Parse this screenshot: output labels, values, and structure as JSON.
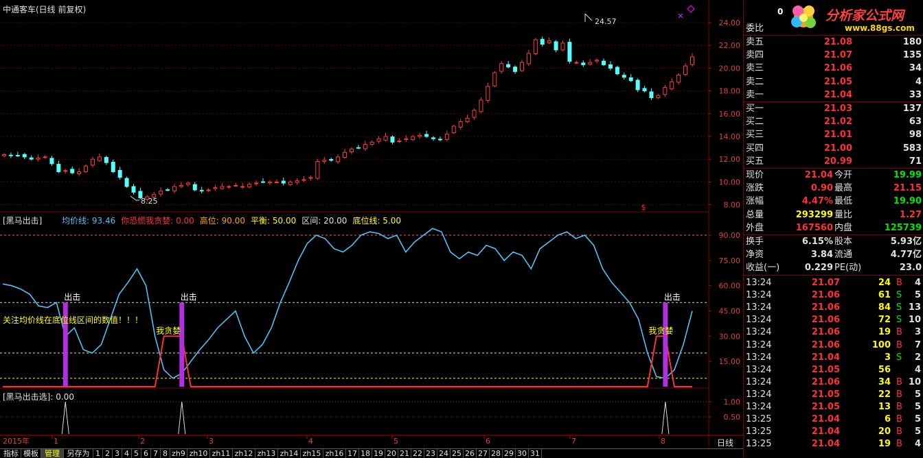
{
  "header": {
    "stock_title": "中通客车(日线 前复权)",
    "peak_label": "24.57",
    "low_label": "8.25",
    "price_ticks": [
      "24.00",
      "22.00",
      "20.00",
      "18.00",
      "16.00",
      "14.00",
      "12.00",
      "10.00",
      "8.00"
    ]
  },
  "indicator1": {
    "name": "[黑马出击]",
    "params": [
      {
        "label": "均价线: 93.46",
        "color": "#4fc3f7"
      },
      {
        "label": "你恐慌我贪婪: 0.00",
        "color": "#ff3232"
      },
      {
        "label": "高位: 90.00",
        "color": "#ffa500"
      },
      {
        "label": "平衡: 50.00",
        "color": "#ffff00"
      },
      {
        "label": "区间: 20.00",
        "color": "#e0e0e0"
      },
      {
        "label": "底位线: 5.00",
        "color": "#ffff00"
      }
    ],
    "ticks": [
      "90.00",
      "75.00",
      "60.00",
      "45.00",
      "30.00",
      "15.00"
    ],
    "notice": "关注均价线在底位线区间的数值！！！",
    "signal_label": "出击",
    "greed_label": "我贪婪"
  },
  "indicator2": {
    "name": "[黑马出击选]",
    "value": ": 0.00",
    "ticks": [
      "1.00",
      "0.50"
    ]
  },
  "axis": {
    "year_label": "2015年",
    "months": [
      "1",
      "2",
      "3",
      "4",
      "5",
      "6",
      "7",
      "8"
    ],
    "period": "日线"
  },
  "bottom_tabs": [
    "指标",
    "模板",
    "管理",
    "另存为",
    "1",
    "2",
    "3",
    "4",
    "5",
    "6",
    "7",
    "8",
    "zh9",
    "zh10",
    "zh11",
    "zh12",
    "zh13",
    "zh14",
    "zh15",
    "zh16",
    "17",
    "18",
    "19",
    "20",
    "21",
    "22",
    "23",
    "24",
    "25",
    "26",
    "27",
    "28",
    "29",
    "30",
    "31"
  ],
  "logo": {
    "text": "分析家公式网",
    "url": "www.88gs.com",
    "pre": "0"
  },
  "order_book": {
    "title": "委比",
    "sells": [
      {
        "label": "卖五",
        "price": "21.08",
        "vol": "180"
      },
      {
        "label": "卖四",
        "price": "21.07",
        "vol": "135"
      },
      {
        "label": "卖三",
        "price": "21.06",
        "vol": "34"
      },
      {
        "label": "卖二",
        "price": "21.05",
        "vol": "4"
      },
      {
        "label": "卖一",
        "price": "21.04",
        "vol": "33"
      }
    ],
    "buys": [
      {
        "label": "买一",
        "price": "21.03",
        "vol": "137"
      },
      {
        "label": "买二",
        "price": "21.02",
        "vol": "63"
      },
      {
        "label": "买三",
        "price": "21.01",
        "vol": "98"
      },
      {
        "label": "买四",
        "price": "21.00",
        "vol": "583"
      },
      {
        "label": "买五",
        "price": "20.99",
        "vol": "71"
      }
    ]
  },
  "stats": [
    {
      "l1": "现价",
      "v1": "21.04",
      "c1": "red",
      "l2": "今开",
      "v2": "19.99",
      "c2": "green"
    },
    {
      "l1": "涨跌",
      "v1": "0.90",
      "c1": "red",
      "l2": "最高",
      "v2": "21.15",
      "c2": "red"
    },
    {
      "l1": "涨幅",
      "v1": "4.47%",
      "c1": "red",
      "l2": "最低",
      "v2": "19.90",
      "c2": "green"
    },
    {
      "l1": "总量",
      "v1": "293299",
      "c1": "yellow",
      "l2": "量比",
      "v2": "1.27",
      "c2": "red"
    },
    {
      "l1": "外盘",
      "v1": "167560",
      "c1": "red",
      "l2": "内盘",
      "v2": "125739",
      "c2": "green"
    }
  ],
  "stats2": [
    {
      "l1": "换手",
      "v1": "6.15%",
      "l2": "股本",
      "v2": "5.93亿"
    },
    {
      "l1": "净资",
      "v1": "3.84",
      "l2": "流通",
      "v2": "4.77亿"
    },
    {
      "l1": "收益(一)",
      "v1": "0.229",
      "l2": "PE(动)",
      "v2": "23.0"
    }
  ],
  "trades": [
    {
      "t": "13:24",
      "p": "21.07",
      "v": "24",
      "s": "B",
      "n": "4"
    },
    {
      "t": "13:24",
      "p": "21.06",
      "v": "61",
      "s": "S",
      "n": "5"
    },
    {
      "t": "13:24",
      "p": "21.06",
      "v": "84",
      "s": "S",
      "n": "13"
    },
    {
      "t": "13:24",
      "p": "21.06",
      "v": "72",
      "s": "S",
      "n": "10"
    },
    {
      "t": "13:24",
      "p": "21.06",
      "v": "19",
      "s": "B",
      "n": "3"
    },
    {
      "t": "13:24",
      "p": "21.06",
      "v": "100",
      "s": "B",
      "n": "7"
    },
    {
      "t": "13:24",
      "p": "21.04",
      "v": "3",
      "s": "S",
      "n": "2"
    },
    {
      "t": "13:24",
      "p": "21.05",
      "v": "56",
      "s": "",
      "n": "4"
    },
    {
      "t": "13:24",
      "p": "21.06",
      "v": "34",
      "s": "B",
      "n": "10"
    },
    {
      "t": "13:24",
      "p": "21.05",
      "v": "22",
      "s": "B",
      "n": "5"
    },
    {
      "t": "13:24",
      "p": "21.05",
      "v": "13",
      "s": "B",
      "n": "5"
    },
    {
      "t": "13:25",
      "p": "21.04",
      "v": "6",
      "s": "B",
      "n": "5"
    },
    {
      "t": "13:25",
      "p": "21.04",
      "v": "20",
      "s": "B",
      "n": "5"
    },
    {
      "t": "13:25",
      "p": "21.04",
      "v": "19",
      "s": "B",
      "n": "4"
    }
  ],
  "chart_data": [
    {
      "type": "line",
      "title": "黑马出击",
      "series": [
        {
          "name": "均价线",
          "color": "#4fc3f7",
          "values": [
            61,
            60,
            58,
            55,
            48,
            47,
            50,
            30,
            35,
            22,
            20,
            25,
            40,
            55,
            62,
            70,
            60,
            30,
            10,
            5,
            8,
            15,
            22,
            28,
            35,
            40,
            45,
            30,
            20,
            25,
            35,
            50,
            62,
            75,
            85,
            90,
            88,
            82,
            80,
            84,
            90,
            92,
            91,
            88,
            90,
            80,
            86,
            90,
            94,
            92,
            80,
            76,
            80,
            78,
            84,
            82,
            75,
            80,
            78,
            70,
            82,
            86,
            90,
            92,
            88,
            90,
            84,
            70,
            62,
            56,
            50,
            40,
            20,
            6,
            5,
            10,
            25,
            45
          ]
        },
        {
          "name": "你恐慌我贪婪",
          "color": "#ff3232",
          "values": [
            0,
            0,
            0,
            0,
            0,
            0,
            0,
            0,
            0,
            0,
            0,
            0,
            0,
            0,
            0,
            0,
            0,
            0,
            30,
            30,
            30,
            0,
            0,
            0,
            0,
            0,
            0,
            0,
            0,
            0,
            0,
            0,
            0,
            0,
            0,
            0,
            0,
            0,
            0,
            0,
            0,
            0,
            0,
            0,
            0,
            0,
            0,
            0,
            0,
            0,
            0,
            0,
            0,
            0,
            0,
            0,
            0,
            0,
            0,
            0,
            0,
            0,
            0,
            0,
            0,
            0,
            0,
            0,
            0,
            0,
            0,
            0,
            0,
            30,
            30,
            0,
            0,
            0
          ]
        }
      ],
      "reference_lines": [
        90,
        50,
        20,
        5
      ],
      "signals_at": [
        7,
        20,
        74
      ],
      "ylim": [
        0,
        100
      ]
    },
    {
      "type": "line",
      "title": "黑马出击选",
      "series": [
        {
          "name": "黑马出击选",
          "values_at_signals": [
            1,
            1,
            1
          ]
        }
      ],
      "ylim": [
        0,
        1.2
      ]
    }
  ]
}
